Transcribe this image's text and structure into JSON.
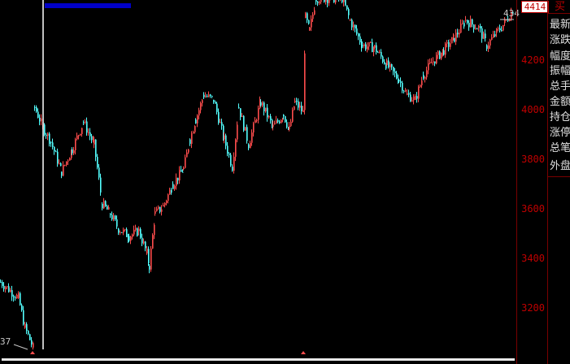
{
  "chart_data": {
    "type": "candlestick",
    "y_axis": {
      "ticks": [
        "4200",
        "4000",
        "3800",
        "3600",
        "3400",
        "3200"
      ],
      "min": 3030,
      "max": 4440
    },
    "current_price": "4414",
    "markers": {
      "left_low": "37",
      "right_high": "434"
    },
    "colors": {
      "up": "#ff4d4d",
      "down": "#54ffff",
      "axis": "#c00000",
      "cursor": "#ffffff"
    },
    "segments": [
      [
        0,
        3305
      ],
      [
        22,
        3240
      ],
      [
        30,
        3120
      ],
      [
        40,
        3040
      ],
      [
        42,
        4010
      ],
      [
        52,
        3930
      ],
      [
        62,
        3870
      ],
      [
        75,
        3750
      ],
      [
        88,
        3840
      ],
      [
        102,
        3950
      ],
      [
        115,
        3860
      ],
      [
        125,
        3620
      ],
      [
        135,
        3580
      ],
      [
        145,
        3520
      ],
      [
        158,
        3490
      ],
      [
        170,
        3510
      ],
      [
        180,
        3420
      ],
      [
        183,
        3370
      ],
      [
        190,
        3580
      ],
      [
        200,
        3610
      ],
      [
        212,
        3700
      ],
      [
        225,
        3760
      ],
      [
        233,
        3880
      ],
      [
        240,
        3960
      ],
      [
        250,
        4060
      ],
      [
        262,
        4040
      ],
      [
        275,
        3880
      ],
      [
        285,
        3770
      ],
      [
        293,
        4010
      ],
      [
        305,
        3860
      ],
      [
        320,
        4030
      ],
      [
        335,
        3930
      ],
      [
        348,
        3980
      ],
      [
        355,
        3920
      ],
      [
        362,
        4030
      ],
      [
        372,
        3990
      ],
      [
        375,
        4370
      ],
      [
        380,
        4320
      ],
      [
        388,
        4450
      ],
      [
        420,
        4450
      ],
      [
        430,
        4360
      ],
      [
        445,
        4260
      ],
      [
        460,
        4250
      ],
      [
        475,
        4180
      ],
      [
        490,
        4120
      ],
      [
        500,
        4060
      ],
      [
        510,
        4040
      ],
      [
        520,
        4140
      ],
      [
        530,
        4190
      ],
      [
        545,
        4240
      ],
      [
        558,
        4290
      ],
      [
        572,
        4360
      ],
      [
        588,
        4330
      ],
      [
        598,
        4260
      ],
      [
        610,
        4310
      ],
      [
        620,
        4350
      ],
      [
        632,
        4414
      ]
    ],
    "candles_per_segment_width": 3
  },
  "side_panel": {
    "buy": "买",
    "labels": [
      "最新",
      "涨跌",
      "幅度",
      "振幅",
      "总手",
      "金额",
      "持仓",
      "涨停",
      "总笔",
      "外盘"
    ]
  }
}
